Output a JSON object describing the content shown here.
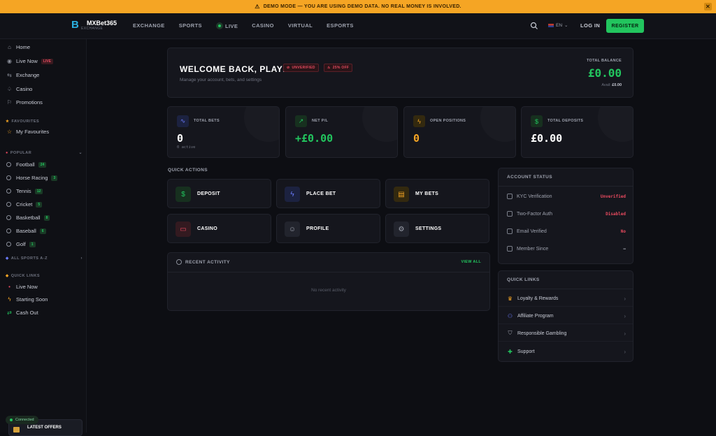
{
  "banner": {
    "text": "DEMO MODE — YOU ARE USING DEMO DATA. NO REAL MONEY IS INVOLVED.",
    "close": "✕"
  },
  "header": {
    "brand": "MXBet365",
    "brand_sub": "EXCHANGE",
    "nav": [
      "EXCHANGE",
      "SPORTS",
      "LIVE",
      "CASINO",
      "VIRTUAL",
      "ESPORTS"
    ],
    "lang": "EN",
    "login": "LOG IN",
    "register": "REGISTER"
  },
  "sidebar": {
    "main": [
      {
        "label": "Home",
        "icon": "home-icon"
      },
      {
        "label": "Live Now",
        "icon": "live-icon",
        "badge": "LIVE"
      },
      {
        "label": "Exchange",
        "icon": "exchange-icon"
      },
      {
        "label": "Casino",
        "icon": "casino-icon"
      },
      {
        "label": "Promotions",
        "icon": "promotions-icon"
      }
    ],
    "favourites_title": "FAVOURITES",
    "favourites_item": "My Favourites",
    "popular_title": "POPULAR",
    "sports": [
      {
        "label": "Football",
        "count": "24"
      },
      {
        "label": "Horse Racing",
        "count": "3"
      },
      {
        "label": "Tennis",
        "count": "12"
      },
      {
        "label": "Cricket",
        "count": "5"
      },
      {
        "label": "Basketball",
        "count": "8"
      },
      {
        "label": "Baseball",
        "count": "6"
      },
      {
        "label": "Golf",
        "count": "1"
      }
    ],
    "all_sports": "ALL SPORTS A-Z",
    "quick_title": "QUICK LINKS",
    "quick": [
      "Live Now",
      "Starting Soon",
      "Cash Out"
    ],
    "connected": "Connected",
    "offers": "LATEST OFFERS"
  },
  "welcome": {
    "title": "WELCOME BACK, PLAYER",
    "subtitle": "Manage your account, bets, and settings",
    "pill_unverified": "UNVERIFIED",
    "pill_age": "25% OFF",
    "balance_label": "TOTAL BALANCE",
    "balance": "£0.00",
    "avail_label": "Avail:",
    "avail": "£0.00"
  },
  "stats": [
    {
      "label": "TOTAL BETS",
      "value": "0",
      "sub": "0 active",
      "color": "#ffffff"
    },
    {
      "label": "NET P/L",
      "value": "+£0.00",
      "sub": "",
      "color": "#22c55e"
    },
    {
      "label": "OPEN POSITIONS",
      "value": "0",
      "sub": "",
      "color": "#f5a524"
    },
    {
      "label": "TOTAL DEPOSITS",
      "value": "£0.00",
      "sub": "",
      "color": "#ffffff"
    }
  ],
  "quick_actions": {
    "title": "QUICK ACTIONS",
    "items": [
      "DEPOSIT",
      "PLACE BET",
      "MY BETS",
      "CASINO",
      "PROFILE",
      "SETTINGS"
    ]
  },
  "recent": {
    "title": "RECENT ACTIVITY",
    "view_all": "VIEW ALL",
    "empty": "No recent activity"
  },
  "account": {
    "title": "ACCOUNT STATUS",
    "rows": [
      {
        "label": "KYC Verification",
        "value": "Unverified",
        "color": "#e84a5f"
      },
      {
        "label": "Two-Factor Auth",
        "value": "Disabled",
        "color": "#e84a5f"
      },
      {
        "label": "Email Verified",
        "value": "No",
        "color": "#e84a5f"
      },
      {
        "label": "Member Since",
        "value": "—",
        "color": "#c9ccd6"
      }
    ]
  },
  "links": {
    "title": "QUICK LINKS",
    "items": [
      "Loyalty & Rewards",
      "Affiliate Program",
      "Responsible Gambling",
      "Support"
    ]
  }
}
